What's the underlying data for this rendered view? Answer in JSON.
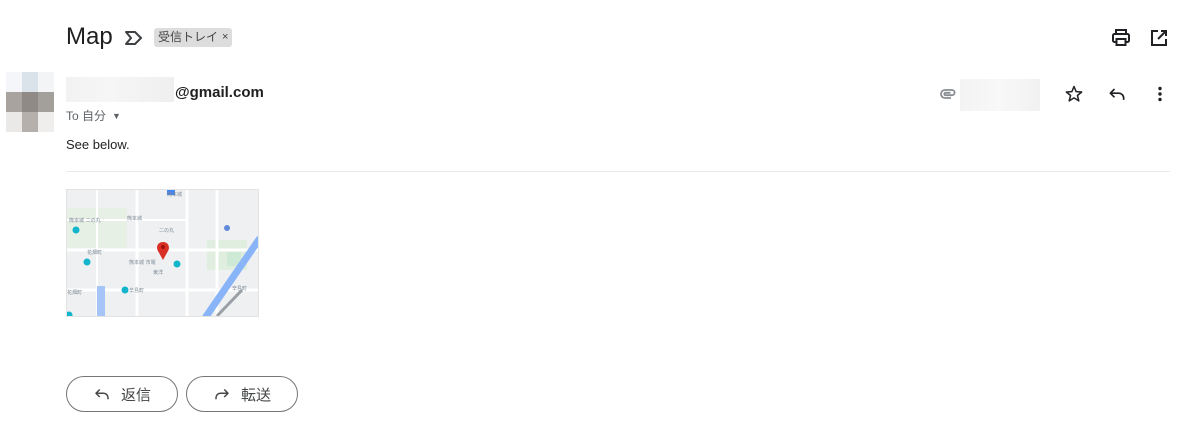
{
  "header": {
    "subject": "Map",
    "label": "受信トレイ",
    "label_remove": "×"
  },
  "message": {
    "sender_domain": "@gmail.com",
    "to_label": "To 自分",
    "body": "See below.",
    "attachment": {
      "map_labels": [
        "熊本城",
        "二の丸",
        "東洋",
        "市電",
        "花畑町",
        "辛島町"
      ]
    }
  },
  "actions": {
    "reply_label": "返信",
    "forward_label": "転送"
  },
  "icons": {
    "important": "importance-marker-icon",
    "print": "print-icon",
    "open_new_window": "open-in-new-window-icon",
    "attachment": "paperclip-icon",
    "star": "star-icon",
    "reply": "reply-icon",
    "more": "more-vert-icon",
    "forward": "forward-icon"
  },
  "colors": {
    "chip_bg": "#dddddd",
    "map_pin": "#d93025",
    "map_road": "#8ab4f8",
    "map_park": "#ceead6"
  }
}
